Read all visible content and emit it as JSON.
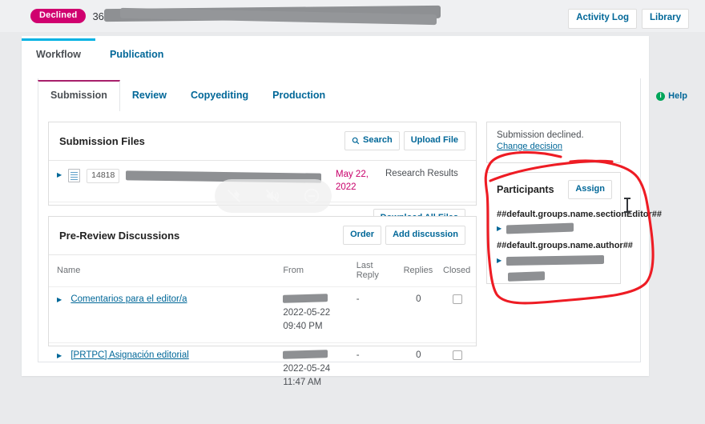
{
  "header": {
    "status_badge": "Declined",
    "submission_id": "3612",
    "separator": "/",
    "title_redacted": true,
    "activity_log_label": "Activity Log",
    "library_label": "Library"
  },
  "primary_tabs": [
    {
      "label": "Workflow",
      "active": true
    },
    {
      "label": "Publication",
      "active": false
    }
  ],
  "stage_tabs": [
    {
      "label": "Submission",
      "active": true
    },
    {
      "label": "Review",
      "active": false
    },
    {
      "label": "Copyediting",
      "active": false
    },
    {
      "label": "Production",
      "active": false
    }
  ],
  "help": {
    "label": "Help",
    "icon": "info-icon",
    "icon_glyph": "i"
  },
  "submission_files": {
    "title": "Submission Files",
    "search_label": "Search",
    "search_icon": "magnifier-icon",
    "upload_label": "Upload File",
    "download_all_label": "Download All Files",
    "rows": [
      {
        "expander": "▶",
        "file_icon": "document-icon",
        "file_id": "14818",
        "file_name": "[redacted]",
        "date": "May 22, 2022",
        "genre": "Research Results"
      }
    ]
  },
  "discussions": {
    "title": "Pre-Review Discussions",
    "order_label": "Order",
    "add_label": "Add discussion",
    "columns": [
      "Name",
      "From",
      "Last Reply",
      "Replies",
      "Closed"
    ],
    "rows": [
      {
        "expander": "▶",
        "name": "Comentarios para el editor/a",
        "from_user": "[redacted]",
        "from_date": "2022-05-22",
        "from_time": "09:40 PM",
        "last_reply": "-",
        "replies": "0",
        "closed": false
      },
      {
        "expander": "▶",
        "name": "[PRTPC] Asignación editorial",
        "from_user": "[redacted]",
        "from_date": "2022-05-24",
        "from_time": "11:47 AM",
        "last_reply": "-",
        "replies": "0",
        "closed": false
      }
    ]
  },
  "decision_panel": {
    "status_text": "Submission declined.",
    "change_link": "Change decision"
  },
  "participants": {
    "title": "Participants",
    "assign_label": "Assign",
    "groups": [
      {
        "label": "##default.groups.name.sectionEditor##",
        "members": [
          {
            "name": "[redacted]",
            "expander": "▶"
          }
        ]
      },
      {
        "label": "##default.groups.name.author##",
        "members": [
          {
            "name": "[redacted]",
            "expander": "▶"
          },
          {
            "name": "[redacted]",
            "expander": ""
          }
        ]
      }
    ]
  },
  "meeting_overlay": {
    "pin_off_icon": "pin-off-icon",
    "mute_icon": "microphone-muted-icon",
    "minimize_icon": "minus-circle-icon"
  },
  "annotation": {
    "type": "hand-drawn-circle",
    "color": "#ee1c24",
    "target": "participants-panel"
  },
  "colors": {
    "accent_blue": "#006798",
    "status_magenta": "#d0006f",
    "tab_cyan": "#00b2e3",
    "tab_plum": "#a8206b",
    "page_bg": "#e9eaec",
    "annotation_red": "#ee1c24"
  }
}
